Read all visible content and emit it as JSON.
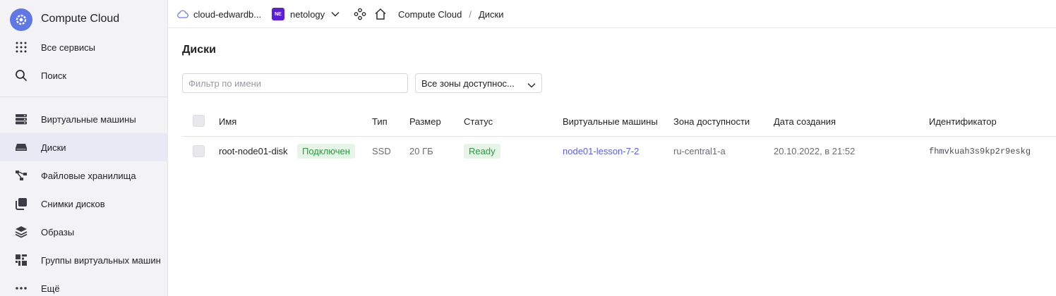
{
  "sidebar": {
    "title": "Compute Cloud",
    "top_items": [
      {
        "label": "Все сервисы",
        "icon": "grid-icon"
      },
      {
        "label": "Поиск",
        "icon": "search-icon"
      }
    ],
    "items": [
      {
        "label": "Виртуальные машины",
        "icon": "server-icon"
      },
      {
        "label": "Диски",
        "icon": "disk-icon",
        "active": true
      },
      {
        "label": "Файловые хранилища",
        "icon": "file-storage-icon"
      },
      {
        "label": "Снимки дисков",
        "icon": "snapshot-icon"
      },
      {
        "label": "Образы",
        "icon": "layers-icon"
      },
      {
        "label": "Группы виртуальных машин",
        "icon": "instance-group-icon"
      },
      {
        "label": "Ещё",
        "icon": "more-icon"
      }
    ]
  },
  "topbar": {
    "cloud": "cloud-edwardb...",
    "folder_badge": "NE",
    "folder": "netology",
    "breadcrumb": [
      "Compute Cloud",
      "Диски"
    ],
    "separator": "/"
  },
  "page": {
    "title": "Диски",
    "filter_placeholder": "Фильтр по имени",
    "zone_select": "Все зоны доступнос..."
  },
  "table": {
    "columns": [
      "Имя",
      "Тип",
      "Размер",
      "Статус",
      "Виртуальные машины",
      "Зона доступности",
      "Дата создания",
      "Идентификатор"
    ],
    "rows": [
      {
        "name": "root-node01-disk",
        "attached": "Подключен",
        "type": "SSD",
        "size": "20 ГБ",
        "status": "Ready",
        "vm": "node01-lesson-7-2",
        "zone": "ru-central1-a",
        "created": "20.10.2022, в 21:52",
        "id": "fhmvkuah3s9kp2r9eskg"
      }
    ]
  },
  "colors": {
    "accent": "#5a5ff0",
    "ready_bg": "#e6f5e8",
    "ready_text": "#2b9a3f",
    "folder_badge": "#5b1fd6",
    "logo": "#5f78e6"
  }
}
